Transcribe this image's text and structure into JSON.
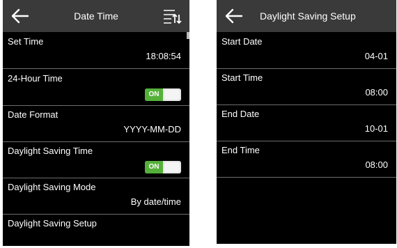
{
  "left_screen": {
    "title": "Date Time",
    "back_icon": "arrow-left-icon",
    "menu_icon": "sort-menu-icon",
    "rows": [
      {
        "label": "Set Time",
        "value": "18:08:54"
      },
      {
        "label": "24-Hour Time",
        "toggle": "ON"
      },
      {
        "label": "Date Format",
        "value": "YYYY-MM-DD"
      },
      {
        "label": "Daylight Saving Time",
        "toggle": "ON"
      },
      {
        "label": "Daylight Saving Mode",
        "value": "By date/time"
      },
      {
        "label": "Daylight Saving Setup"
      }
    ]
  },
  "right_screen": {
    "title": "Daylight Saving Setup",
    "back_icon": "arrow-left-icon",
    "rows": [
      {
        "label": "Start Date",
        "value": "04-01"
      },
      {
        "label": "Start Time",
        "value": "08:00"
      },
      {
        "label": "End Date",
        "value": "10-01"
      },
      {
        "label": "End Time",
        "value": "08:00"
      }
    ]
  },
  "colors": {
    "header_bg": "#3a3a3a",
    "screen_bg": "#000000",
    "toggle_on": "#55b03a",
    "divider": "#6e6e6e"
  }
}
